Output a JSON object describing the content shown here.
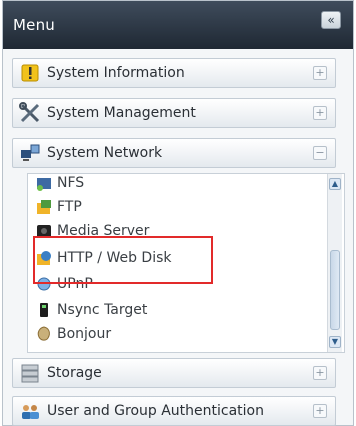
{
  "menu": {
    "title": "Menu",
    "collapse_glyph": "«"
  },
  "sections": [
    {
      "label": "System Information",
      "icon": "info-icon",
      "toggle": "+"
    },
    {
      "label": "System Management",
      "icon": "tools-icon",
      "toggle": "+"
    },
    {
      "label": "System Network",
      "icon": "network-icon",
      "toggle": "−"
    },
    {
      "label": "Storage",
      "icon": "storage-icon",
      "toggle": "+"
    },
    {
      "label": "User and Group Authentication",
      "icon": "users-icon",
      "toggle": "+"
    }
  ],
  "network_items": [
    {
      "label": "NFS",
      "icon": "nfs-icon"
    },
    {
      "label": "FTP",
      "icon": "ftp-icon"
    },
    {
      "label": "Media Server",
      "icon": "media-server-icon"
    },
    {
      "label": "HTTP / Web Disk",
      "icon": "web-disk-icon",
      "highlighted": true
    },
    {
      "label": "UPnP",
      "icon": "upnp-icon"
    },
    {
      "label": "Nsync Target",
      "icon": "nsync-icon"
    },
    {
      "label": "Bonjour",
      "icon": "bonjour-icon"
    }
  ],
  "colors": {
    "header_bg": "#1f2833",
    "highlight_border": "#e22a2a"
  }
}
